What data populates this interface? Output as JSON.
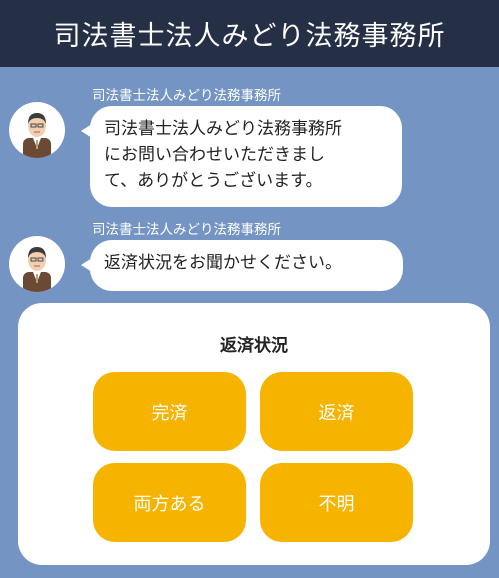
{
  "header": {
    "title": "司法書士法人みどり法務事務所"
  },
  "messages": [
    {
      "sender": "司法書士法人みどり法務事務所",
      "lines": [
        "司法書士法人みどり法務事務所",
        "にお問い合わせいただきまし",
        "て、ありがとうございます。"
      ]
    },
    {
      "sender": "司法書士法人みどり法務事務所",
      "lines": [
        "返済状況をお聞かせください。"
      ]
    }
  ],
  "panel": {
    "title": "返済状況",
    "options": [
      "完済",
      "返済",
      "両方ある",
      "不明"
    ]
  },
  "colors": {
    "header_bg": "#253047",
    "page_bg": "#7495c3",
    "option_bg": "#f6b400",
    "option_text": "#ffffff"
  }
}
